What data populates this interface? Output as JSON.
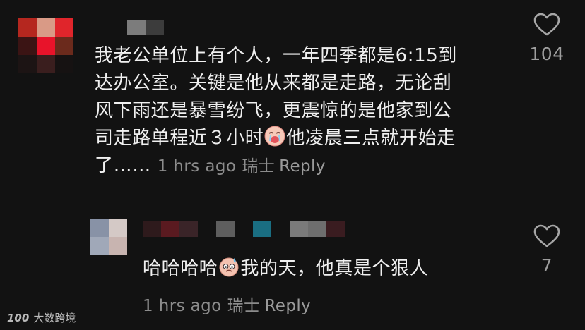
{
  "top_comment": {
    "line1": "我老公单位上有个人，一年四季都是6:15到",
    "line2": "达办公室。关键是他从来都是走路，无论刮",
    "line3": "风下雨还是暴雪纷飞，更震惊的是他家到公",
    "line4_a": "司走路单程近３小时",
    "line4_b": "他凌晨三点就开始走",
    "line5": "了……",
    "emoji": "crying-face-emoji",
    "time": "1 hrs ago",
    "location": "瑞士",
    "reply_label": "Reply",
    "like_icon": "heart-outline-icon",
    "like_count": "104"
  },
  "reply_comment": {
    "text_a": "哈哈哈哈",
    "text_b": "我的天，他真是个狠人",
    "emoji": "sweating-face-emoji",
    "time": "1 hrs ago",
    "location": "瑞士",
    "reply_label": "Reply",
    "like_icon": "heart-outline-icon",
    "like_count": "7"
  },
  "watermark": {
    "logo": "100",
    "text": "大数跨境"
  },
  "colors": {
    "background": "#121212",
    "text": "#f0f0f0",
    "meta": "#8c8c8c",
    "avatar_mosaic_top": [
      "#b5271f",
      "#d99a86",
      "#e0252b",
      "#3b1414",
      "#e8132a",
      "#6b2a1c",
      "#1c1414",
      "#3a1e1e",
      "#161212"
    ],
    "name_mosaic_top": [
      "#7c7c7c",
      "#3c3c3c"
    ],
    "avatar_mosaic_reply": [
      "#8892a6",
      "#d4c9c6",
      "#a0a8b8",
      "#c8b4b0"
    ],
    "name_mosaic_reply": [
      "#2e1a1c",
      "#5a1a20",
      "#3a2428",
      "#121212",
      "#5e5e5e",
      "#121212",
      "#1a6e82",
      "#121212",
      "#7a7a7a",
      "#6e6e6e",
      "#3a1c20"
    ]
  }
}
